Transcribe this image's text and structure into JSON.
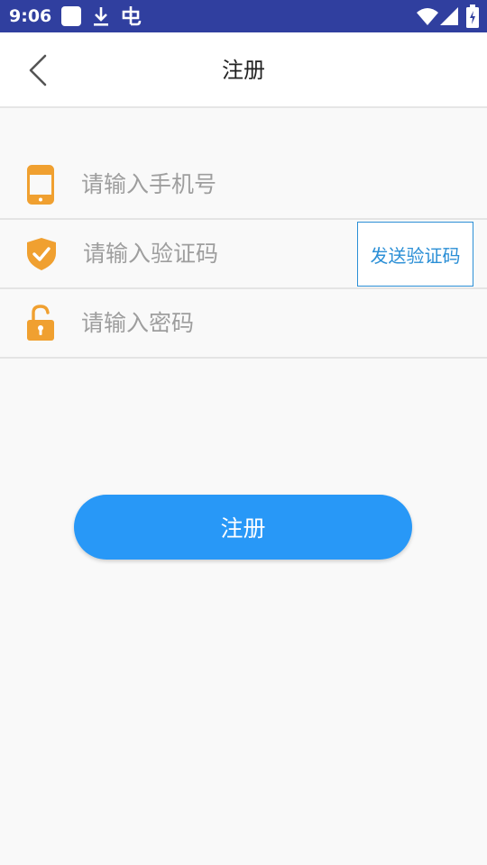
{
  "status_bar": {
    "time": "9:06",
    "icons": [
      "app-notification-icon",
      "download-icon",
      "bug-icon",
      "wifi-icon",
      "signal-icon",
      "battery-icon"
    ]
  },
  "header": {
    "title": "注册",
    "back_icon": "chevron-left-icon"
  },
  "form": {
    "phone": {
      "placeholder": "请输入手机号",
      "value": "",
      "icon": "phone-icon"
    },
    "code": {
      "placeholder": "请输入验证码",
      "value": "",
      "icon": "shield-check-icon",
      "send_label": "发送验证码"
    },
    "password": {
      "placeholder": "请输入密码",
      "value": "",
      "icon": "lock-open-icon"
    }
  },
  "register_button": {
    "label": "注册"
  },
  "colors": {
    "status_bar": "#303f9f",
    "accent": "#2898f7",
    "icon_orange": "#f0a030",
    "send_code": "#2b8fd6"
  }
}
